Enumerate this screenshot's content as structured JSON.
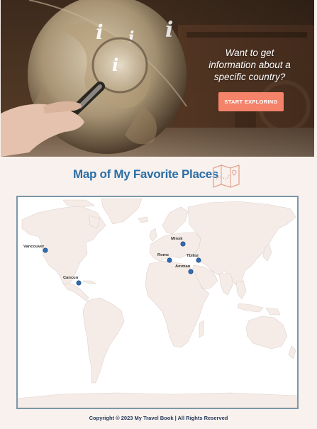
{
  "hero": {
    "question_line1": "Want to get",
    "question_line2": "information about a",
    "question_line3": "specific country?",
    "cta_label": "START EXPLORING",
    "cta_color": "#f4836a"
  },
  "map_section": {
    "title": "Map of My Favorite Places",
    "title_color": "#2a6ea5",
    "border_color": "#7c97a9",
    "land_color": "#f6ece7",
    "marker_color": "#2f6db3",
    "places": [
      {
        "name": "Vancouver"
      },
      {
        "name": "Cancun"
      },
      {
        "name": "Minsk"
      },
      {
        "name": "Rome"
      },
      {
        "name": "Tbilisi"
      },
      {
        "name": "Amman"
      }
    ]
  },
  "footer": {
    "copyright": "Copyright © 2023 My Travel Book | All Rights Reserved"
  }
}
